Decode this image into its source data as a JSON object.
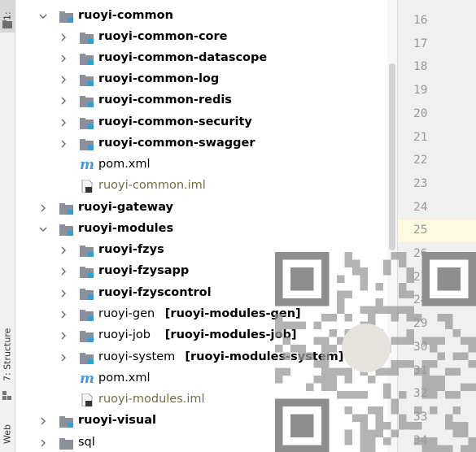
{
  "side_tabs": {
    "project": "1:",
    "structure": "7: Structure",
    "web": "Web"
  },
  "tree": {
    "rows": [
      {
        "label": "ruoyi-common",
        "bold": true,
        "suffix": ""
      },
      {
        "label": "ruoyi-common-core",
        "bold": true,
        "suffix": ""
      },
      {
        "label": "ruoyi-common-datascope",
        "bold": true,
        "suffix": ""
      },
      {
        "label": "ruoyi-common-log",
        "bold": true,
        "suffix": ""
      },
      {
        "label": "ruoyi-common-redis",
        "bold": true,
        "suffix": ""
      },
      {
        "label": "ruoyi-common-security",
        "bold": true,
        "suffix": ""
      },
      {
        "label": "ruoyi-common-swagger",
        "bold": true,
        "suffix": ""
      },
      {
        "label": "pom.xml",
        "bold": false,
        "suffix": ""
      },
      {
        "label": "ruoyi-common.iml",
        "bold": false,
        "suffix": ""
      },
      {
        "label": "ruoyi-gateway",
        "bold": true,
        "suffix": ""
      },
      {
        "label": "ruoyi-modules",
        "bold": true,
        "suffix": ""
      },
      {
        "label": "ruoyi-fzys",
        "bold": true,
        "suffix": ""
      },
      {
        "label": "ruoyi-fzysapp",
        "bold": true,
        "suffix": ""
      },
      {
        "label": "ruoyi-fzyscontrol",
        "bold": true,
        "suffix": ""
      },
      {
        "label": "ruoyi-gen",
        "bold": false,
        "suffix": "[ruoyi-modules-gen]"
      },
      {
        "label": "ruoyi-job",
        "bold": false,
        "suffix": "[ruoyi-modules-job]"
      },
      {
        "label": "ruoyi-system",
        "bold": false,
        "suffix": "[ruoyi-modules-system]"
      },
      {
        "label": "pom.xml",
        "bold": false,
        "suffix": ""
      },
      {
        "label": "ruoyi-modules.iml",
        "bold": false,
        "suffix": ""
      },
      {
        "label": "ruoyi-visual",
        "bold": true,
        "suffix": ""
      },
      {
        "label": "sql",
        "bold": false,
        "suffix": ""
      }
    ]
  },
  "gutter": {
    "line_numbers": [
      "16",
      "17",
      "18",
      "19",
      "20",
      "21",
      "22",
      "23",
      "24",
      "25",
      "26",
      "27",
      "28",
      "29",
      "30",
      "31",
      "32",
      "33",
      "34"
    ]
  },
  "colors": {
    "folder": "#8a8f99",
    "module_badge": "#2e9fd8",
    "maven_icon": "#4a9ad6",
    "iml_text": "#6f6f44"
  }
}
